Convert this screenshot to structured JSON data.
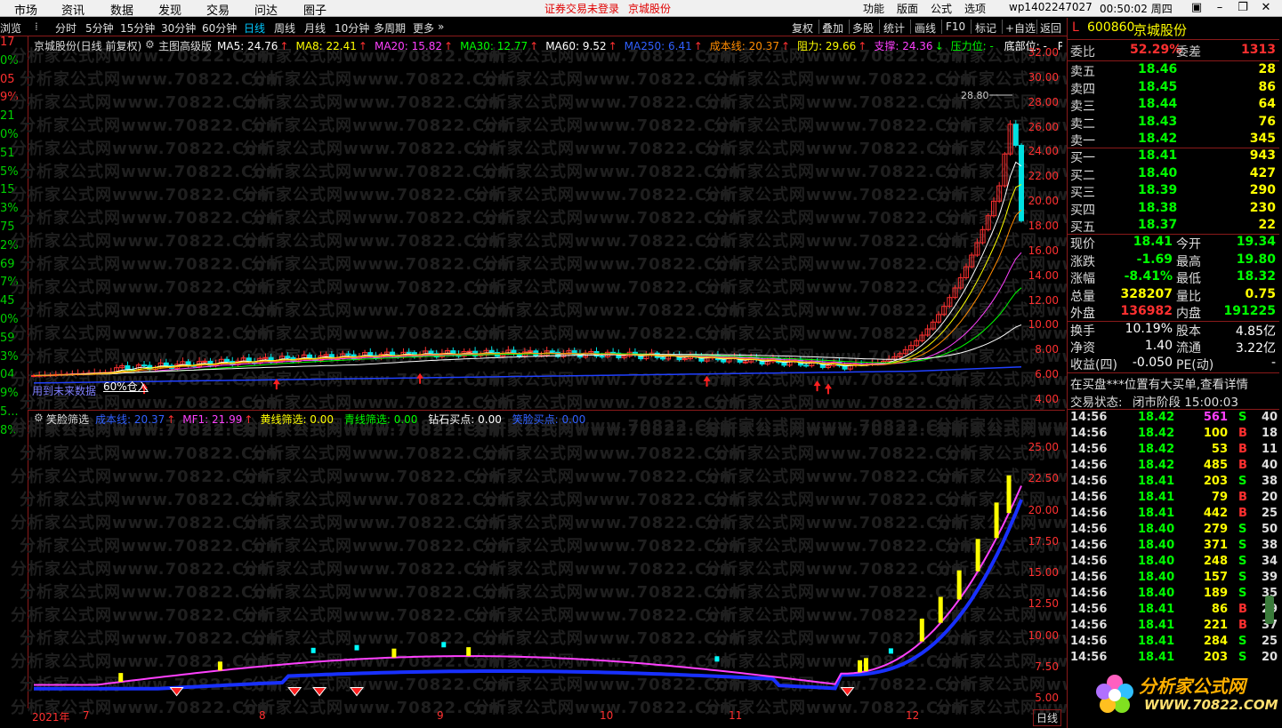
{
  "menu": {
    "items": [
      "市场",
      "资讯",
      "数据",
      "发现",
      "交易",
      "问达",
      "圈子"
    ],
    "notice_1": "证券交易未登录",
    "notice_2": "京城股份",
    "right_items": [
      "功能",
      "版面",
      "公式",
      "选项"
    ],
    "account": "wp1402247027",
    "time": "00:50:02 周四"
  },
  "toolbar": {
    "left_label": "浏览",
    "periods": [
      "分时",
      "5分钟",
      "15分钟",
      "30分钟",
      "60分钟",
      "日线",
      "周线",
      "月线",
      "10分钟",
      "多周期",
      "更多"
    ],
    "active_period": "日线",
    "right_items": [
      "复权",
      "叠加",
      "多股",
      "统计",
      "画线",
      "F10",
      "标记",
      "+自选",
      "返回"
    ]
  },
  "left_strip": [
    {
      "v": "17",
      "c": "#ff3030"
    },
    {
      "v": "0%",
      "c": "#00d000"
    },
    {
      "v": "05",
      "c": "#ff3030"
    },
    {
      "v": "9%",
      "c": "#ff3030"
    },
    {
      "v": "21",
      "c": "#00d000"
    },
    {
      "v": "0%",
      "c": "#00d000"
    },
    {
      "v": "51",
      "c": "#00d000"
    },
    {
      "v": "5%",
      "c": "#00d000"
    },
    {
      "v": "15",
      "c": "#00d000"
    },
    {
      "v": "3%",
      "c": "#00d000"
    },
    {
      "v": "75",
      "c": "#00d000"
    },
    {
      "v": "2%",
      "c": "#00d000"
    },
    {
      "v": "69",
      "c": "#00d000"
    },
    {
      "v": "7%",
      "c": "#00d000"
    },
    {
      "v": "45",
      "c": "#00d000"
    },
    {
      "v": "0%",
      "c": "#00d000"
    },
    {
      "v": "59",
      "c": "#00d000"
    },
    {
      "v": "3%",
      "c": "#00d000"
    },
    {
      "v": "04",
      "c": "#00d000"
    },
    {
      "v": "9%",
      "c": "#00d000"
    },
    {
      "v": "5...",
      "c": "#00d000"
    },
    {
      "v": "8%",
      "c": "#00d000"
    }
  ],
  "main_chart": {
    "title": "京城股份(日线 前复权)",
    "indicator": "主图高级版",
    "legend": [
      {
        "t": "MA5: 24.76",
        "c": "#ffffff",
        "arrow": "↑"
      },
      {
        "t": "MA8: 22.41",
        "c": "#ffff00",
        "arrow": "↑"
      },
      {
        "t": "MA20: 15.82",
        "c": "#ff40ff",
        "arrow": "↑"
      },
      {
        "t": "MA30: 12.77",
        "c": "#00ff00",
        "arrow": "↑"
      },
      {
        "t": "MA60: 9.52",
        "c": "#ffffff",
        "arrow": "↑"
      },
      {
        "t": "MA250: 6.41",
        "c": "#3060ff",
        "arrow": "↑"
      },
      {
        "t": "成本线: 20.37",
        "c": "#ff8c00",
        "arrow": "↑"
      },
      {
        "t": "阻力: 29.66",
        "c": "#ffff00",
        "arrow": "↑"
      },
      {
        "t": "支撑: 24.36",
        "c": "#ff40ff",
        "arrow": "↓"
      },
      {
        "t": "压力位: -",
        "c": "#00ff00",
        "arrow": ""
      },
      {
        "t": "底部位: -",
        "c": "#ffffff",
        "arrow": ""
      },
      {
        "t": "PMA: 24.76",
        "c": "#ffffff",
        "arrow": ""
      }
    ],
    "y_ticks": [
      "32.00",
      "30.00",
      "28.00",
      "26.00",
      "24.00",
      "22.00",
      "20.00",
      "18.00",
      "16.00",
      "14.00",
      "12.00",
      "10.00",
      "8.00",
      "6.00",
      "4.00"
    ],
    "peak_label": "28.80",
    "note": "用到未来数据",
    "note2": "60%仓入"
  },
  "sub_chart": {
    "indicator": "笑脸筛选",
    "legend": [
      {
        "t": "成本线: 20.37",
        "c": "#3060ff",
        "arrow": "↑"
      },
      {
        "t": "MF1: 21.99",
        "c": "#ff40ff",
        "arrow": "↑"
      },
      {
        "t": "黄线筛选: 0.00",
        "c": "#ffff00",
        "arrow": ""
      },
      {
        "t": "青线筛选: 0.00",
        "c": "#00ff00",
        "arrow": ""
      },
      {
        "t": "钻石买点: 0.00",
        "c": "#ffffff",
        "arrow": ""
      },
      {
        "t": "笑脸买点: 0.00",
        "c": "#3060ff",
        "arrow": ""
      }
    ],
    "y_ticks": [
      "25.00",
      "22.50",
      "20.00",
      "17.50",
      "15.00",
      "12.50",
      "10.00",
      "7.50",
      "5.00"
    ]
  },
  "dates": [
    "2021年",
    "7",
    "8",
    "9",
    "10",
    "11",
    "12"
  ],
  "date_tab": "日线",
  "watermark": "分析家公式网www.70822.Com",
  "logo": {
    "line1": "分析家公式网",
    "line2": "WWW.70822.COM"
  },
  "quote": {
    "code": "600860",
    "name": "京城股份",
    "weibi_label": "委比",
    "weibi": "52.29%",
    "weicha_label": "委差",
    "weicha": "1313",
    "asks": [
      {
        "l": "卖五",
        "p": "18.46",
        "v": "28"
      },
      {
        "l": "卖四",
        "p": "18.45",
        "v": "86"
      },
      {
        "l": "卖三",
        "p": "18.44",
        "v": "64"
      },
      {
        "l": "卖二",
        "p": "18.43",
        "v": "76"
      },
      {
        "l": "卖一",
        "p": "18.42",
        "v": "345"
      }
    ],
    "bids": [
      {
        "l": "买一",
        "p": "18.41",
        "v": "943"
      },
      {
        "l": "买二",
        "p": "18.40",
        "v": "427"
      },
      {
        "l": "买三",
        "p": "18.39",
        "v": "290"
      },
      {
        "l": "买四",
        "p": "18.38",
        "v": "230"
      },
      {
        "l": "买五",
        "p": "18.37",
        "v": "22"
      }
    ],
    "stats": [
      {
        "l1": "现价",
        "v1": "18.41",
        "c1": "#00ff00",
        "l2": "今开",
        "v2": "19.34",
        "c2": "#00ff00"
      },
      {
        "l1": "涨跌",
        "v1": "-1.69",
        "c1": "#00ff00",
        "l2": "最高",
        "v2": "19.80",
        "c2": "#00ff00"
      },
      {
        "l1": "涨幅",
        "v1": "-8.41%",
        "c1": "#00ff00",
        "l2": "最低",
        "v2": "18.32",
        "c2": "#00ff00"
      },
      {
        "l1": "总量",
        "v1": "328207",
        "c1": "#ffff00",
        "l2": "量比",
        "v2": "0.75",
        "c2": "#ffff00"
      },
      {
        "l1": "外盘",
        "v1": "136982",
        "c1": "#ff3030",
        "l2": "内盘",
        "v2": "191225",
        "c2": "#00ff00"
      }
    ],
    "stats2": [
      {
        "l1": "换手",
        "v1": "10.19%",
        "l2": "股本",
        "v2": "4.85亿"
      },
      {
        "l1": "净资",
        "v1": "1.40",
        "l2": "流通",
        "v2": "3.22亿"
      },
      {
        "l1": "收益(四)",
        "v1": "-0.050",
        "l2": "PE(动)",
        "v2": "-"
      }
    ],
    "msg": "在买盘***位置有大买单,查看详情",
    "status_label": "交易状态:",
    "status": "闭市阶段 15:00:03"
  },
  "ticks": [
    {
      "t": "14:56",
      "p": "18.42",
      "v": "561",
      "s": "S",
      "n": "40",
      "vc": "#ff40ff"
    },
    {
      "t": "14:56",
      "p": "18.42",
      "v": "100",
      "s": "B",
      "n": "18",
      "vc": "#ffff00"
    },
    {
      "t": "14:56",
      "p": "18.42",
      "v": "53",
      "s": "B",
      "n": "11",
      "vc": "#ffff00"
    },
    {
      "t": "14:56",
      "p": "18.42",
      "v": "485",
      "s": "B",
      "n": "40",
      "vc": "#ffff00"
    },
    {
      "t": "14:56",
      "p": "18.41",
      "v": "203",
      "s": "S",
      "n": "38",
      "vc": "#ffff00"
    },
    {
      "t": "14:56",
      "p": "18.41",
      "v": "79",
      "s": "B",
      "n": "20",
      "vc": "#ffff00"
    },
    {
      "t": "14:56",
      "p": "18.41",
      "v": "442",
      "s": "B",
      "n": "25",
      "vc": "#ffff00"
    },
    {
      "t": "14:56",
      "p": "18.40",
      "v": "279",
      "s": "S",
      "n": "50",
      "vc": "#ffff00"
    },
    {
      "t": "14:56",
      "p": "18.40",
      "v": "371",
      "s": "S",
      "n": "38",
      "vc": "#ffff00"
    },
    {
      "t": "14:56",
      "p": "18.40",
      "v": "248",
      "s": "S",
      "n": "34",
      "vc": "#ffff00"
    },
    {
      "t": "14:56",
      "p": "18.40",
      "v": "157",
      "s": "S",
      "n": "39",
      "vc": "#ffff00"
    },
    {
      "t": "14:56",
      "p": "18.40",
      "v": "189",
      "s": "S",
      "n": "35",
      "vc": "#ffff00"
    },
    {
      "t": "14:56",
      "p": "18.41",
      "v": "86",
      "s": "B",
      "n": "29",
      "vc": "#ffff00"
    },
    {
      "t": "14:56",
      "p": "18.41",
      "v": "221",
      "s": "B",
      "n": "37",
      "vc": "#ffff00"
    },
    {
      "t": "14:56",
      "p": "18.41",
      "v": "284",
      "s": "S",
      "n": "25",
      "vc": "#ffff00"
    },
    {
      "t": "14:56",
      "p": "18.41",
      "v": "203",
      "s": "S",
      "n": "20",
      "vc": "#ffff00"
    }
  ],
  "chart_data": {
    "type": "line",
    "x": [
      "2021-06",
      "2021-07",
      "2021-08",
      "2021-09",
      "2021-10",
      "2021-11",
      "2021-12"
    ],
    "series": [
      {
        "name": "成本线",
        "values": [
          5.8,
          5.9,
          6.5,
          7.8,
          7.4,
          6.8,
          20.37
        ]
      },
      {
        "name": "MF1",
        "values": [
          6.2,
          6.5,
          8.4,
          8.6,
          7.6,
          6.9,
          21.99
        ]
      }
    ],
    "ylim": [
      4,
      32
    ]
  }
}
